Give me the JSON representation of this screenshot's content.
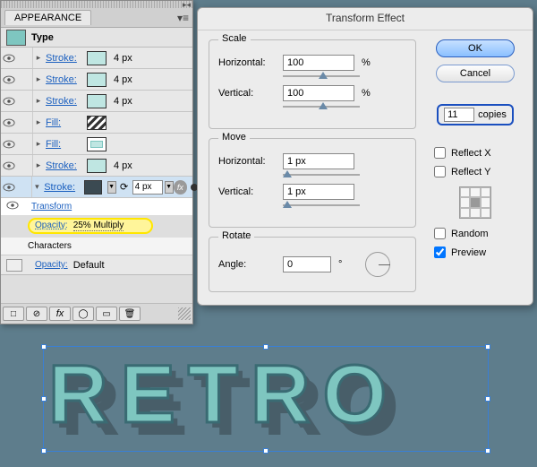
{
  "appearance": {
    "panel_title": "APPEARANCE",
    "type_label": "Type",
    "rows": [
      {
        "label": "Stroke:",
        "size": "4 px",
        "swatch": "teal"
      },
      {
        "label": "Stroke:",
        "size": "4 px",
        "swatch": "teal"
      },
      {
        "label": "Stroke:",
        "size": "4 px",
        "swatch": "teal"
      },
      {
        "label": "Fill:",
        "size": "",
        "swatch": "chevron"
      },
      {
        "label": "Fill:",
        "size": "",
        "swatch": "nested"
      },
      {
        "label": "Stroke:",
        "size": "4 px",
        "swatch": "teal"
      }
    ],
    "selected_row": {
      "label": "Stroke:",
      "size_value": "4 px",
      "swatch": "dark"
    },
    "transform_link": "Transform",
    "opacity_link": "Opacity:",
    "opacity_value": "25% Multiply",
    "characters_label": "Characters",
    "default_opacity_link": "Opacity:",
    "default_opacity_value": "Default",
    "footer_icons": [
      "□",
      "⊘",
      "fx",
      "◯",
      "▭",
      "🗑"
    ]
  },
  "dialog": {
    "title": "Transform Effect",
    "scale": {
      "legend": "Scale",
      "h_label": "Horizontal:",
      "h_value": "100",
      "v_label": "Vertical:",
      "v_value": "100",
      "unit": "%"
    },
    "move": {
      "legend": "Move",
      "h_label": "Horizontal:",
      "h_value": "1 px",
      "v_label": "Vertical:",
      "v_value": "1 px"
    },
    "rotate": {
      "legend": "Rotate",
      "a_label": "Angle:",
      "a_value": "0",
      "unit": "°"
    },
    "ok": "OK",
    "cancel": "Cancel",
    "copies_value": "11",
    "copies_label": "copies",
    "reflect_x": "Reflect X",
    "reflect_y": "Reflect Y",
    "random": "Random",
    "preview": "Preview",
    "reflect_x_checked": false,
    "reflect_y_checked": false,
    "random_checked": false,
    "preview_checked": true
  },
  "art_text": "RETRO"
}
